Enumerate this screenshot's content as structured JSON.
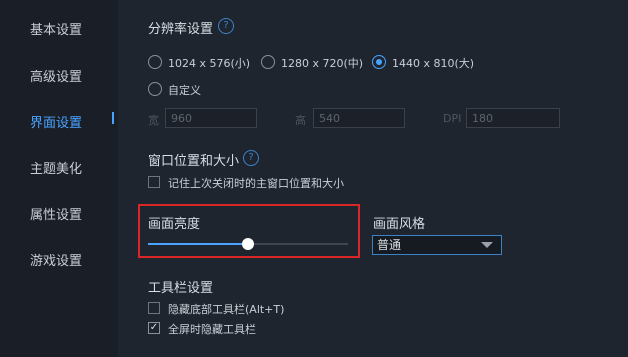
{
  "sidebar": {
    "items": [
      {
        "label": "基本设置"
      },
      {
        "label": "高级设置"
      },
      {
        "label": "界面设置"
      },
      {
        "label": "主题美化"
      },
      {
        "label": "属性设置"
      },
      {
        "label": "游戏设置"
      }
    ],
    "active_index": 2
  },
  "resolution": {
    "title": "分辨率设置",
    "options": [
      "1024 x 576(小)",
      "1280 x 720(中)",
      "1440 x 810(大)",
      "自定义"
    ],
    "selected": "1440 x 810(大)",
    "width_label": "宽",
    "width_value": "960",
    "height_label": "高",
    "height_value": "540",
    "dpi_label": "DPI",
    "dpi_value": "180"
  },
  "window_position": {
    "title": "窗口位置和大小",
    "remember_label": "记住上次关闭时的主窗口位置和大小",
    "remember_checked": false
  },
  "brightness": {
    "title": "画面亮度",
    "level_fraction": 0.5
  },
  "style": {
    "title": "画面风格",
    "selected": "普通"
  },
  "toolbar": {
    "title": "工具栏设置",
    "hide_bottom_label": "隐藏底部工具栏(Alt+T)",
    "hide_bottom_checked": false,
    "fullscreen_hide_label": "全屏时隐藏工具栏",
    "fullscreen_hide_checked": true
  },
  "icons": {
    "help": "question-circle-icon",
    "dropdown": "chevron-down-icon",
    "check": "check-icon"
  },
  "colors": {
    "accent": "#4aa3ff",
    "highlight_border": "#d92626"
  }
}
